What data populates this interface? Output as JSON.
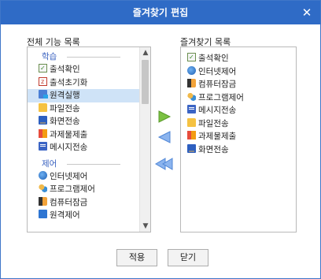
{
  "window": {
    "title": "즐겨찾기 편집",
    "close_label": "✕"
  },
  "left": {
    "label": "전체 기능 목록",
    "groups": [
      {
        "name": "학습",
        "items": [
          {
            "label": "출석확인",
            "icon": "check-icon",
            "selected": false
          },
          {
            "label": "출석초기화",
            "icon": "attendance-reset-icon",
            "selected": false
          },
          {
            "label": "원격실행",
            "icon": "remote-run-icon",
            "selected": true
          },
          {
            "label": "파일전송",
            "icon": "folder-icon",
            "selected": false
          },
          {
            "label": "화면전송",
            "icon": "screen-send-icon",
            "selected": false
          },
          {
            "label": "과제물제출",
            "icon": "assignment-icon",
            "selected": false
          },
          {
            "label": "메시지전송",
            "icon": "message-icon",
            "selected": false
          }
        ]
      },
      {
        "name": "제어",
        "items": [
          {
            "label": "인터넷제어",
            "icon": "globe-icon",
            "selected": false
          },
          {
            "label": "프로그램제어",
            "icon": "program-icon",
            "selected": false
          },
          {
            "label": "컴퓨터잠금",
            "icon": "lock-icon",
            "selected": false
          },
          {
            "label": "원격제어",
            "icon": "remote-control-icon",
            "selected": false
          }
        ]
      }
    ]
  },
  "right": {
    "label": "즐겨찾기 목록",
    "items": [
      {
        "label": "출석확인",
        "icon": "check-icon"
      },
      {
        "label": "인터넷제어",
        "icon": "globe-icon"
      },
      {
        "label": "컴퓨터잠금",
        "icon": "lock-icon"
      },
      {
        "label": "프로그램제어",
        "icon": "program-icon"
      },
      {
        "label": "메시지전송",
        "icon": "message-icon"
      },
      {
        "label": "파일전송",
        "icon": "folder-icon"
      },
      {
        "label": "과제물제출",
        "icon": "assignment-icon"
      },
      {
        "label": "화면전송",
        "icon": "screen-send-icon"
      }
    ]
  },
  "buttons": {
    "apply": "적용",
    "close": "닫기"
  },
  "colors": {
    "titlebar": "#2f6bc6",
    "selected_row": "#cfe3f7",
    "add_arrow": "#7bc142",
    "remove_arrow": "#5a8fe0"
  }
}
